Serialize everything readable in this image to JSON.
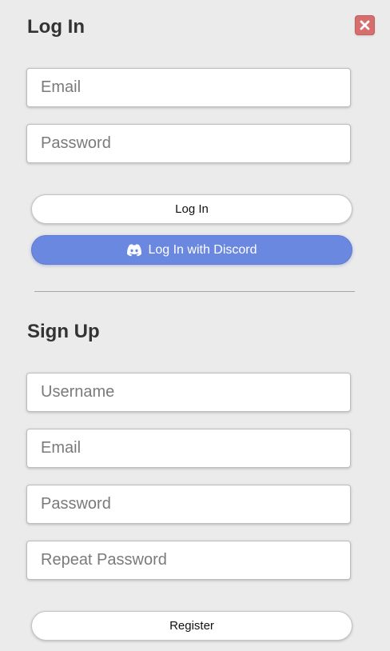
{
  "login": {
    "title": "Log In",
    "email_placeholder": "Email",
    "password_placeholder": "Password",
    "login_button": "Log In",
    "discord_button": "Log In with Discord"
  },
  "signup": {
    "title": "Sign Up",
    "username_placeholder": "Username",
    "email_placeholder": "Email",
    "password_placeholder": "Password",
    "repeat_password_placeholder": "Repeat Password",
    "register_button": "Register"
  },
  "icons": {
    "close": "close-icon",
    "discord": "discord-icon"
  },
  "colors": {
    "background": "#ebebeb",
    "close_button": "#d76e6e",
    "discord_button": "#6b88e1",
    "heading_text": "#333333"
  }
}
